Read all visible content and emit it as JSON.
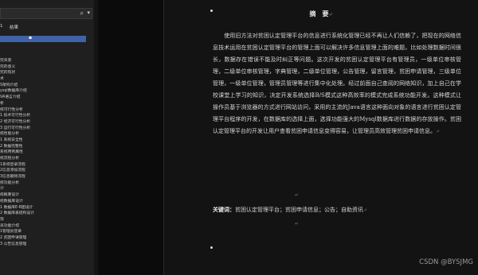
{
  "nav": {
    "search_icon": "search-icon",
    "search_caret": "▾",
    "tabs": [
      "1",
      "结果"
    ],
    "selected_marker": "▪",
    "outline_items": [
      "究背景",
      "究的意义",
      "究的现状",
      "术",
      "S架构介绍",
      "ysql数据库介绍",
      "VA语言介绍",
      "析",
      "统可行性分析",
      "1 技术可行性分析",
      "2 经济可行性分析",
      "3 运行可行性分析",
      "统性能分析",
      "1 系统安全性",
      "2 数据完整性",
      "系统用例属性",
      "统流程分析",
      "1系统登录流程",
      "2信息添加流程",
      "3信息删除流程",
      "统功能分析",
      "计",
      "统概要设计",
      "统数据库设计",
      "1 数据库E-R图设计",
      "2 数据库表结构设计",
      "现",
      "员功能介绍",
      "1管理员登录",
      "2 贫困申请管理",
      "3 公告信息管理"
    ]
  },
  "document": {
    "title": "摘　要",
    "return_mark": "↵",
    "body": "使用旧方法对贫困认定管理平台的信息进行系统化管理已经不再让人们信赖了，把现在的网络信息技术运用在贫困认定管理平台的管理上面可以解决许多信息管理上面的难题，比如处理数据时间很长，数据存在错误不能及时纠正等问题。这次开发的贫困认定管理平台有管理员，一级单位审核管理，二级单位审核管理，字典管理，二级单位管理，公告管理，留言管理，贫困申请管理，三级单位管理，一级单位管理，管理员管理等进行集中化处理。经过前面自己查阅的网络知识，加上自己在学校课堂上学习的知识，决定开发系统选择B/S模式这种高效率的模式完成系统功能开发。这种模式让操作员基于浏览器的方式进行网站访问，采用的主流的Java语言这种面向对象的语言进行贫困认定管理平台程序的开发，在数据库的选择上面，选择功能强大的Mysql数据库进行数据的存放操作。贫困认定管理平台的开发让用户查看贫困申请信息变得容易，让管理员高效管理贫困申请信息。",
    "keywords_label": "关键词：",
    "keywords": "贫困认定管理平台；贫困申请信息；公告；自助资讯"
  },
  "watermark": "CSDN @BYSJMG"
}
